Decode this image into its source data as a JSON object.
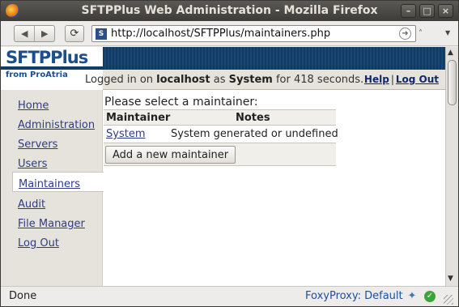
{
  "window": {
    "title": "SFTPPlus Web Administration - Mozilla Firefox",
    "controls": [
      "minimize",
      "maximize",
      "close"
    ]
  },
  "toolbar": {
    "back_icon": "back-arrow-icon",
    "forward_icon": "forward-arrow-icon",
    "reload_icon": "reload-icon",
    "url": "http://localhost/SFTPPlus/maintainers.php"
  },
  "header": {
    "logo_main": "SFTPPlus",
    "logo_sub": "from ProAtria",
    "login_prefix": "Logged in on",
    "host": "localhost",
    "as_word": "as",
    "user": "System",
    "duration": "for 418 seconds.",
    "help_link": "Help",
    "separator": "|",
    "logout_link": "Log Out"
  },
  "sidebar": {
    "items": [
      {
        "label": "Home"
      },
      {
        "label": "Administration"
      },
      {
        "label": "Servers"
      },
      {
        "label": "Users"
      },
      {
        "label": "Maintainers",
        "active": true
      },
      {
        "label": "Audit"
      },
      {
        "label": "File Manager"
      },
      {
        "label": "Log Out"
      }
    ]
  },
  "main": {
    "title": "Please select a maintainer:",
    "columns": [
      "Maintainer",
      "Notes"
    ],
    "rows": [
      {
        "maintainer": "System",
        "notes": "System generated or undefined"
      }
    ],
    "add_button": "Add a new maintainer"
  },
  "statusbar": {
    "status": "Done",
    "proxy": "FoxyProxy: Default"
  },
  "colors": {
    "banner": "#0f3b67",
    "link": "#2f3b8a",
    "sidebar_bg": "#e6e3dc"
  }
}
